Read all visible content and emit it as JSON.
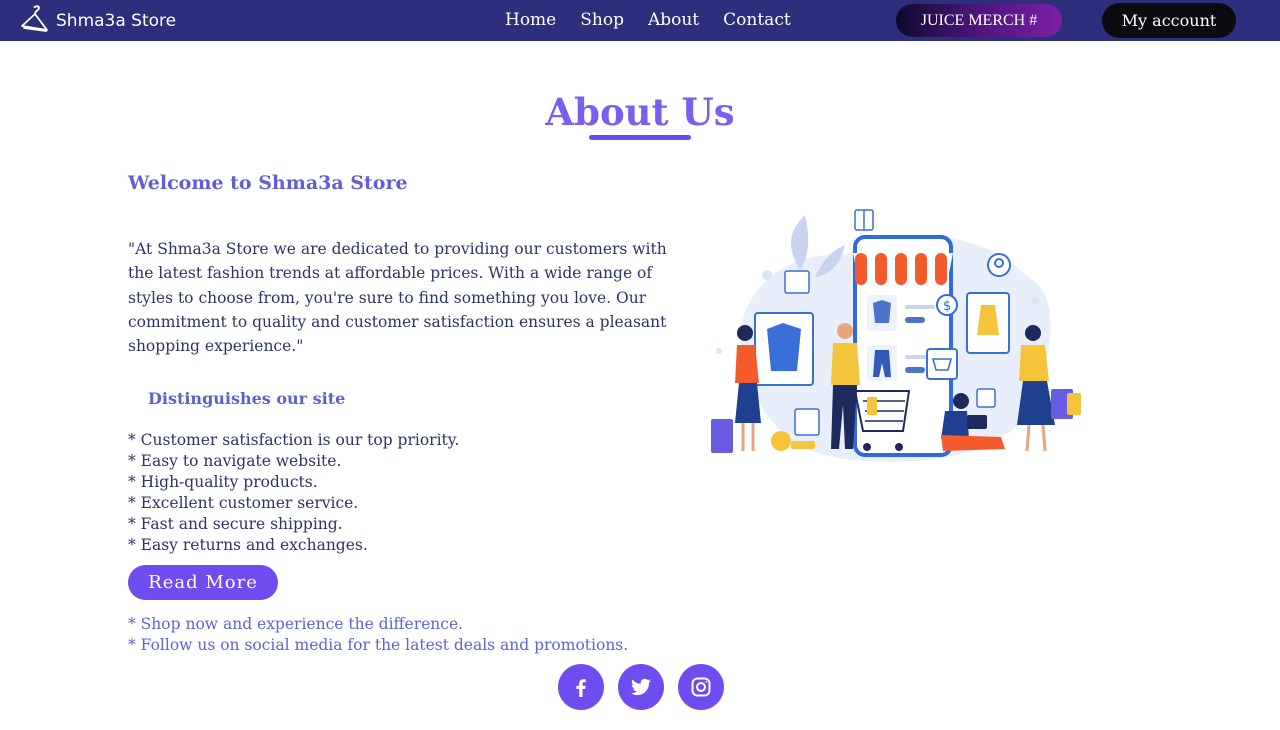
{
  "nav": {
    "brand": "Shma3a Store",
    "brand_icon": "hanger-icon",
    "links": [
      "Home",
      "Shop",
      "About",
      "Contact"
    ],
    "merch_label": "JUICE MERCH #",
    "account_label": "My account",
    "bg_color": "#2d2f7d"
  },
  "main": {
    "title": "About Us",
    "welcome": "Welcome to Shma3a Store",
    "intro": "\"At Shma3a Store we are dedicated to providing our customers with the latest fashion trends at affordable prices. With a wide range of styles to choose from, you're sure to find something you love. Our commitment to quality and customer satisfaction ensures a pleasant shopping experience.\"",
    "distinguish_title": "Distinguishes our site",
    "features": [
      "* Customer satisfaction is our top priority.",
      "* Easy to navigate website.",
      "* High-quality products.",
      "* Excellent customer service.",
      "* Fast and secure shipping.",
      "* Easy returns and exchanges."
    ],
    "read_more": "Read More",
    "notes": [
      "* Shop now and experience the difference.",
      "* Follow us on social media for the latest deals and promotions."
    ],
    "accent_color": "#6e4cf0"
  },
  "social": {
    "icons": [
      "facebook-icon",
      "twitter-icon",
      "instagram-icon"
    ]
  },
  "illustration": {
    "icon": "online-shopping-illustration"
  }
}
